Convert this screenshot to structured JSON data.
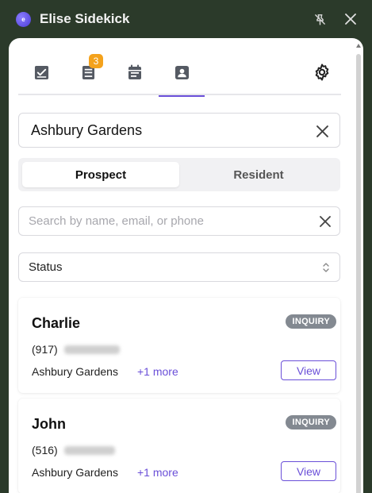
{
  "window": {
    "title": "Elise Sidekick",
    "logo_text": "e",
    "pin_icon": "pin-off-icon",
    "close_icon": "close-icon"
  },
  "tabs": [
    {
      "name": "tasks",
      "icon": "checkbox-icon"
    },
    {
      "name": "messages",
      "icon": "notes-icon",
      "badge": "3"
    },
    {
      "name": "calendar",
      "icon": "calendar-icon"
    },
    {
      "name": "contacts",
      "icon": "contact-card-icon",
      "active": true
    }
  ],
  "settings_icon": "gear-icon",
  "property": {
    "value": "Ashbury Gardens"
  },
  "segments": {
    "prospect": "Prospect",
    "resident": "Resident",
    "active": "prospect"
  },
  "search": {
    "placeholder": "Search by name, email, or phone",
    "value": ""
  },
  "status": {
    "placeholder": "Status"
  },
  "contacts": [
    {
      "name": "Charlie",
      "badge": "INQUIRY",
      "phone": "(917)",
      "property": "Ashbury Gardens",
      "more": "+1 more",
      "action": "View"
    },
    {
      "name": "John",
      "badge": "INQUIRY",
      "phone": "(516)",
      "property": "Ashbury Gardens",
      "more": "+1 more",
      "action": "View"
    }
  ],
  "colors": {
    "accent": "#6a4fd8",
    "badge": "#f4a21c",
    "window_bg": "#2b3a2a",
    "status_badge": "#838991"
  }
}
